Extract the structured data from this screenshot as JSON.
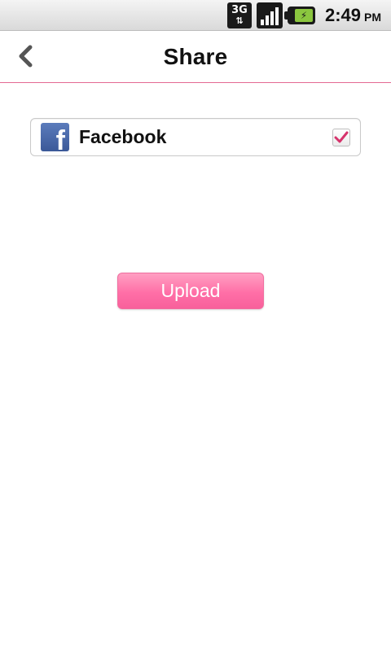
{
  "status_bar": {
    "network_type": "3G",
    "network_arrows": "⇅",
    "time": "2:49",
    "ampm": "PM",
    "icons": [
      "network-3g-icon",
      "signal-strength-icon",
      "battery-charging-icon"
    ]
  },
  "header": {
    "title": "Share",
    "back_icon": "chevron-left-icon"
  },
  "share_options": [
    {
      "label": "Facebook",
      "icon": "facebook-icon",
      "checked": true
    }
  ],
  "actions": {
    "upload_label": "Upload"
  },
  "colors": {
    "accent_pink": "#ff6fa7",
    "divider_pink": "#e46a93",
    "facebook_blue": "#3b5998",
    "checkmark": "#d6336c"
  }
}
